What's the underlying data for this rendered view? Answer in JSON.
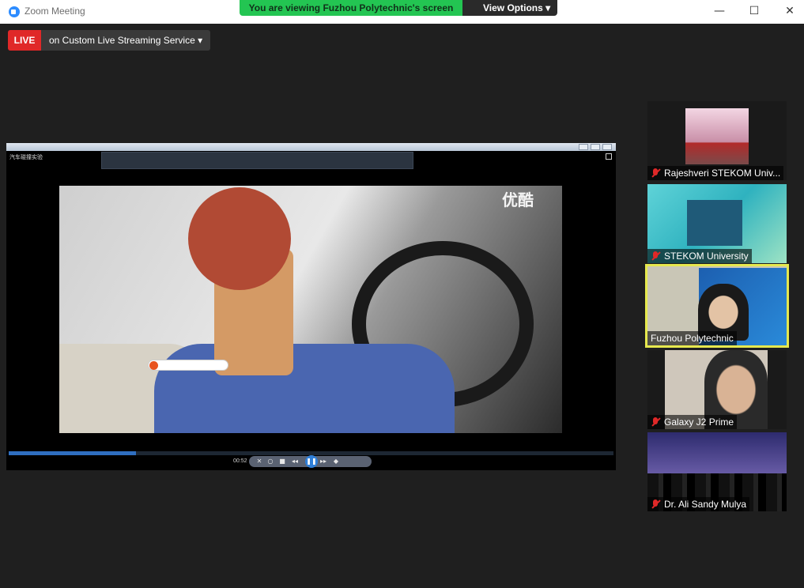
{
  "window": {
    "title": "Zoom Meeting",
    "minimize": "—",
    "maximize": "☐",
    "close": "✕"
  },
  "share_banner": {
    "text": "You are viewing Fuzhou Polytechnic's screen",
    "view_options": "View Options ▾"
  },
  "live": {
    "badge": "LIVE",
    "service": "on Custom Live Streaming Service  ▾"
  },
  "shared_screen": {
    "player_caption": "汽车碰撞实验",
    "watermark": "优酷",
    "elapsed_time": "00:52",
    "progress_fraction": 0.21,
    "controls": {
      "ab": "✕",
      "loop": "○",
      "stop": "■",
      "rewind": "◂◂",
      "play_pause": "❚❚",
      "forward": "▸▸",
      "volume": "◆"
    }
  },
  "participants": [
    {
      "name": "Rajeshveri STEKOM Univ...",
      "muted": true,
      "active": false,
      "thumb": "cherry-blossom-bridge"
    },
    {
      "name": "STEKOM University",
      "muted": true,
      "active": false,
      "thumb": "slide-poster"
    },
    {
      "name": "Fuzhou Polytechnic",
      "muted": false,
      "active": true,
      "thumb": "webcam-person"
    },
    {
      "name": "Galaxy J2 Prime",
      "muted": true,
      "active": false,
      "thumb": "webcam-person"
    },
    {
      "name": "Dr. Ali Sandy Mulya",
      "muted": true,
      "active": false,
      "thumb": "city-skyline-poster"
    }
  ],
  "colors": {
    "background": "#1f1f1f",
    "live_red": "#e02828",
    "banner_green": "#23c552",
    "active_border": "#e6e84e"
  }
}
